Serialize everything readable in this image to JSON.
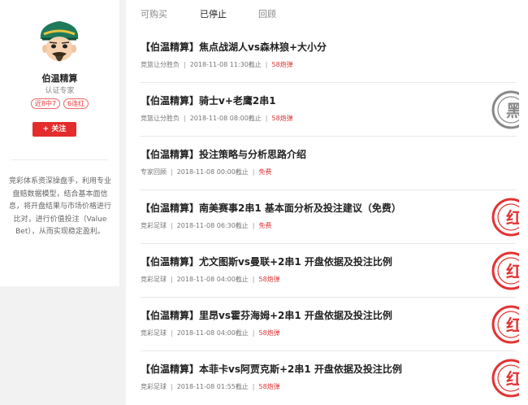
{
  "profile": {
    "name": "伯温精算",
    "role": "认证专家",
    "tags": [
      "近8中7",
      "6连红"
    ],
    "follow_label": "+ 关注",
    "bio": "竞彩体系资深操盘手，利用专业盘赔数据模型，结合基本面信息，将开盘结果与市场价格进行比对，进行价值投注（Value Bet），从而实现稳定盈利。"
  },
  "tabs": [
    {
      "label": "可购买",
      "active": false
    },
    {
      "label": "已停止",
      "active": true
    },
    {
      "label": "回顾",
      "active": false
    }
  ],
  "items": [
    {
      "title": "【伯温精算】焦点战湖人vs森林狼+大小分",
      "category": "竞篮让分胜负",
      "time": "2018-11-08 11:30截止",
      "price": "58炮弹",
      "stamp": "none"
    },
    {
      "title": "【伯温精算】骑士v+老鹰2串1",
      "category": "竞篮让分胜负",
      "time": "2018-11-08 08:00截止",
      "price": "58炮弹",
      "stamp": "黑"
    },
    {
      "title": "【伯温精算】投注策略与分析思路介绍",
      "category": "专家回顾",
      "time": "2018-11-08 00:00截止",
      "price": "免费",
      "stamp": "none"
    },
    {
      "title": "【伯温精算】南美赛事2串1 基本面分析及投注建议（免费）",
      "category": "竞彩足球",
      "time": "2018-11-08 06:30截止",
      "price": "免费",
      "stamp": "红"
    },
    {
      "title": "【伯温精算】尤文图斯vs曼联+2串1 开盘依据及投注比例",
      "category": "竞彩足球",
      "time": "2018-11-08 04:00截止",
      "price": "58炮弹",
      "stamp": "红"
    },
    {
      "title": "【伯温精算】里昂vs霍芬海姆+2串1 开盘依据及投注比例",
      "category": "竞彩足球",
      "time": "2018-11-08 04:00截止",
      "price": "58炮弹",
      "stamp": "红"
    },
    {
      "title": "【伯温精算】本菲卡vs阿贾克斯+2串1 开盘依据及投注比例",
      "category": "竞彩足球",
      "time": "2018-11-08 01:55截止",
      "price": "58炮弹",
      "stamp": "红"
    }
  ],
  "colors": {
    "accent_red": "#e42c2c",
    "stamp_red": "#e33333",
    "stamp_gray": "#888888"
  }
}
